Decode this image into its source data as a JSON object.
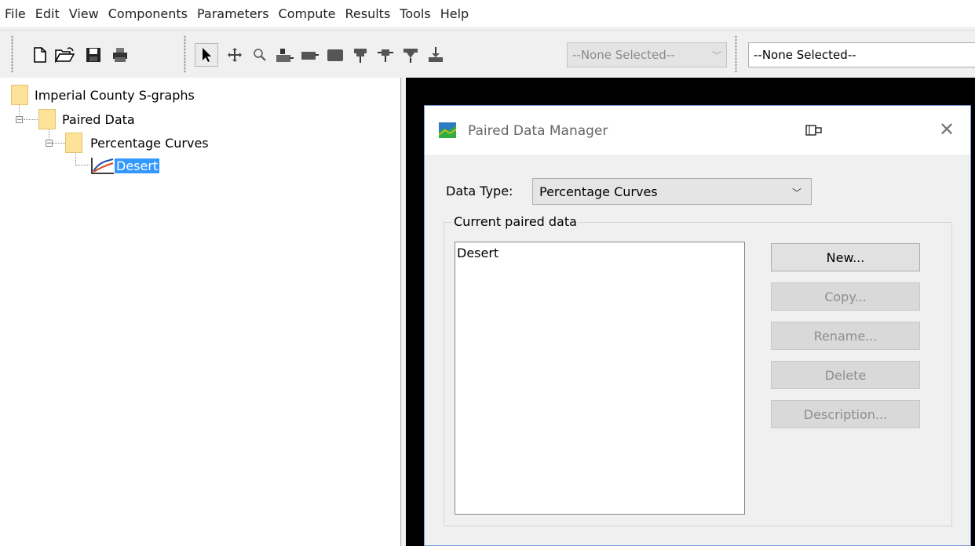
{
  "menu": [
    "File",
    "Edit",
    "View",
    "Components",
    "Parameters",
    "Compute",
    "Results",
    "Tools",
    "Help"
  ],
  "toolbar": {
    "icons": [
      "new-file-icon",
      "open-folder-icon",
      "save-icon",
      "print-icon",
      "select-arrow-icon",
      "pan-icon",
      "zoom-icon",
      "subbasin-icon",
      "reach-icon",
      "reservoir-icon",
      "junction-icon",
      "diversion-icon",
      "sink-icon",
      "source-icon"
    ],
    "combo1": "--None Selected--",
    "combo2": "--None Selected--"
  },
  "tree": {
    "root": "Imperial County S-graphs",
    "paired": "Paired Data",
    "curves": "Percentage Curves",
    "item": "Desert"
  },
  "dialog": {
    "title": "Paired Data Manager",
    "data_type_label": "Data Type:",
    "data_type_value": "Percentage Curves",
    "group_title": "Current paired data",
    "list_items": [
      "Desert"
    ],
    "buttons": {
      "new": "New...",
      "copy": "Copy...",
      "rename": "Rename...",
      "delete": "Delete",
      "description": "Description..."
    }
  },
  "colors": {
    "selection": "#3399ff",
    "folder": "#fde29a",
    "canvas": "#000000"
  }
}
